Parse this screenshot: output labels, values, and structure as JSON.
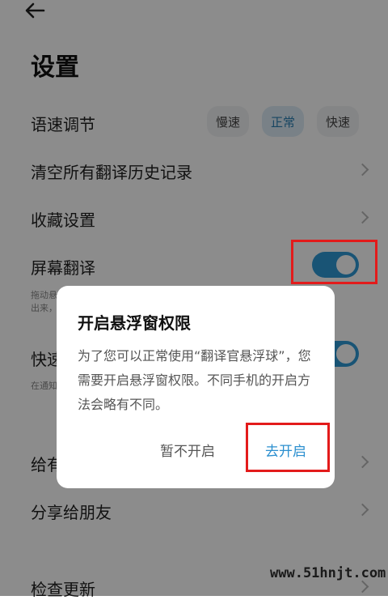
{
  "header": {
    "title": "设置"
  },
  "settings": {
    "speed_label": "语速调节",
    "speed_options": [
      "慢速",
      "正常",
      "快速"
    ],
    "clear_history": "清空所有翻译历史记录",
    "favorites": "收藏设置",
    "screen_translate": "屏幕翻译",
    "screen_translate_sub": "拖动悬",
    "screen_translate_sub2": "出来，",
    "quick_label": "快速",
    "quick_sub": "在通知",
    "rate_label": "给有",
    "share": "分享给朋友",
    "check_update": "检查更新"
  },
  "dialog": {
    "title": "开启悬浮窗权限",
    "message": "为了您可以正常使用“翻译官悬浮球”，您需要开启悬浮窗权限。不同手机的开启方法会略有不同。",
    "cancel": "暂不开启",
    "confirm": "去开启"
  },
  "watermark": "www.51hnjt.com",
  "colors": {
    "accent": "#2f9ad6",
    "highlight": "#e31b1b"
  }
}
